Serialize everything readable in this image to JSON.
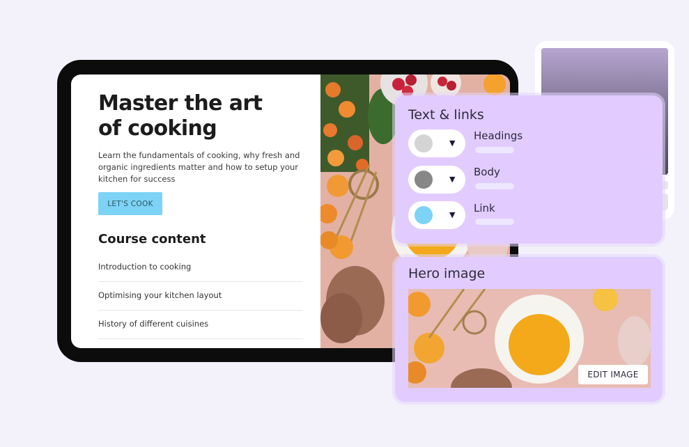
{
  "course_page": {
    "headline_line1": "Master the art",
    "headline_line2": "of cooking",
    "intro": "Learn the fundamentals of cooking, why fresh and organic ingredients matter and how to setup your kitchen for success",
    "cta_label": "LET'S COOK",
    "section_title": "Course content",
    "lessons": [
      "Introduction to cooking",
      "Optimising your kitchen layout",
      "History of different cuisines"
    ]
  },
  "text_links_panel": {
    "title": "Text & links",
    "swatches": [
      {
        "label": "Headings",
        "color": "#d4d4d4"
      },
      {
        "label": "Body",
        "color": "#878787"
      },
      {
        "label": "Link",
        "color": "#7dd3f5"
      }
    ],
    "caret_icon": "caret-down-icon"
  },
  "hero_panel": {
    "title": "Hero image",
    "edit_label": "EDIT IMAGE"
  },
  "colors": {
    "background": "#f3f1fa",
    "panel": "#e2ccff",
    "accent": "#7dd3f5",
    "tablet_frame": "#0c0c0c"
  }
}
